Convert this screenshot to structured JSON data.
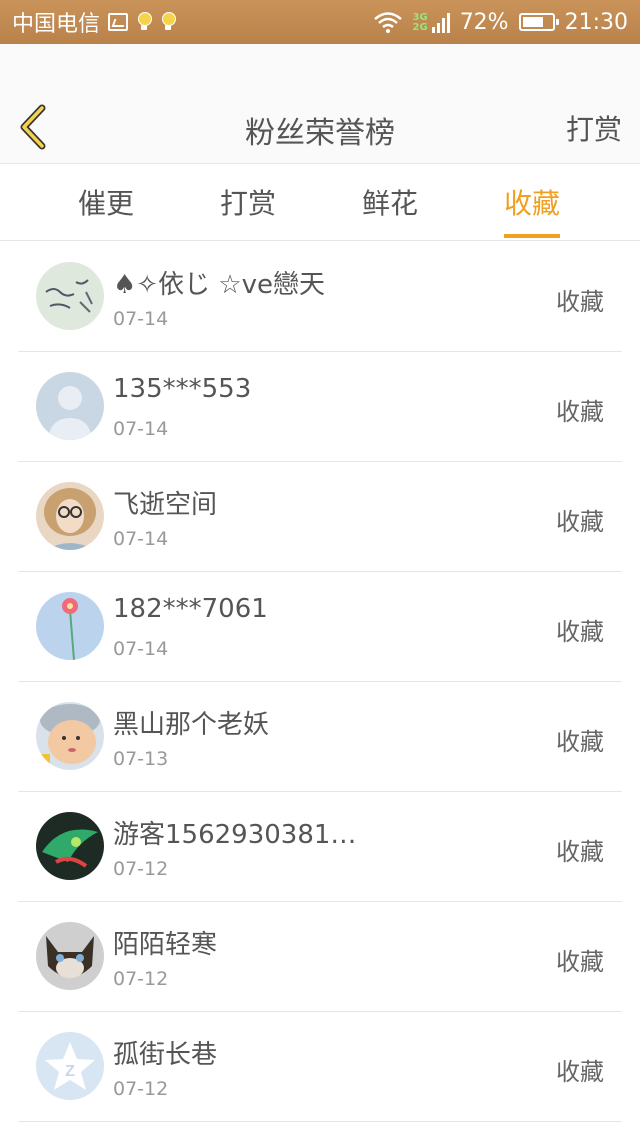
{
  "status_bar": {
    "carrier": "中国电信",
    "network_top": "3G",
    "network_bottom": "2G",
    "battery": "72%",
    "battery_level": 0.72,
    "time": "21:30"
  },
  "header": {
    "title": "粉丝荣誉榜",
    "right_action": "打赏"
  },
  "tabs": [
    {
      "label": "催更",
      "active": false
    },
    {
      "label": "打赏",
      "active": false
    },
    {
      "label": "鲜花",
      "active": false
    },
    {
      "label": "收藏",
      "active": true
    }
  ],
  "colors": {
    "accent": "#f0a020",
    "status_bar": "#c08a52"
  },
  "list": [
    {
      "name": "♠✧依じ ☆ve戀天",
      "date": "07-14",
      "action": "收藏",
      "avatar": "handwriting-avatar"
    },
    {
      "name": "135***553",
      "date": "07-14",
      "action": "收藏",
      "avatar": "default-person-avatar"
    },
    {
      "name": "飞逝空间",
      "date": "07-14",
      "action": "收藏",
      "avatar": "girl-glasses-avatar"
    },
    {
      "name": "182***7061",
      "date": "07-14",
      "action": "收藏",
      "avatar": "flower-avatar"
    },
    {
      "name": "黑山那个老妖",
      "date": "07-13",
      "action": "收藏",
      "avatar": "baby-avatar"
    },
    {
      "name": "游客1562930381…",
      "date": "07-12",
      "action": "收藏",
      "avatar": "game-character-avatar"
    },
    {
      "name": "陌陌轻寒",
      "date": "07-12",
      "action": "收藏",
      "avatar": "cat-avatar"
    },
    {
      "name": "孤街长巷",
      "date": "07-12",
      "action": "收藏",
      "avatar": "qzone-star-avatar"
    }
  ]
}
